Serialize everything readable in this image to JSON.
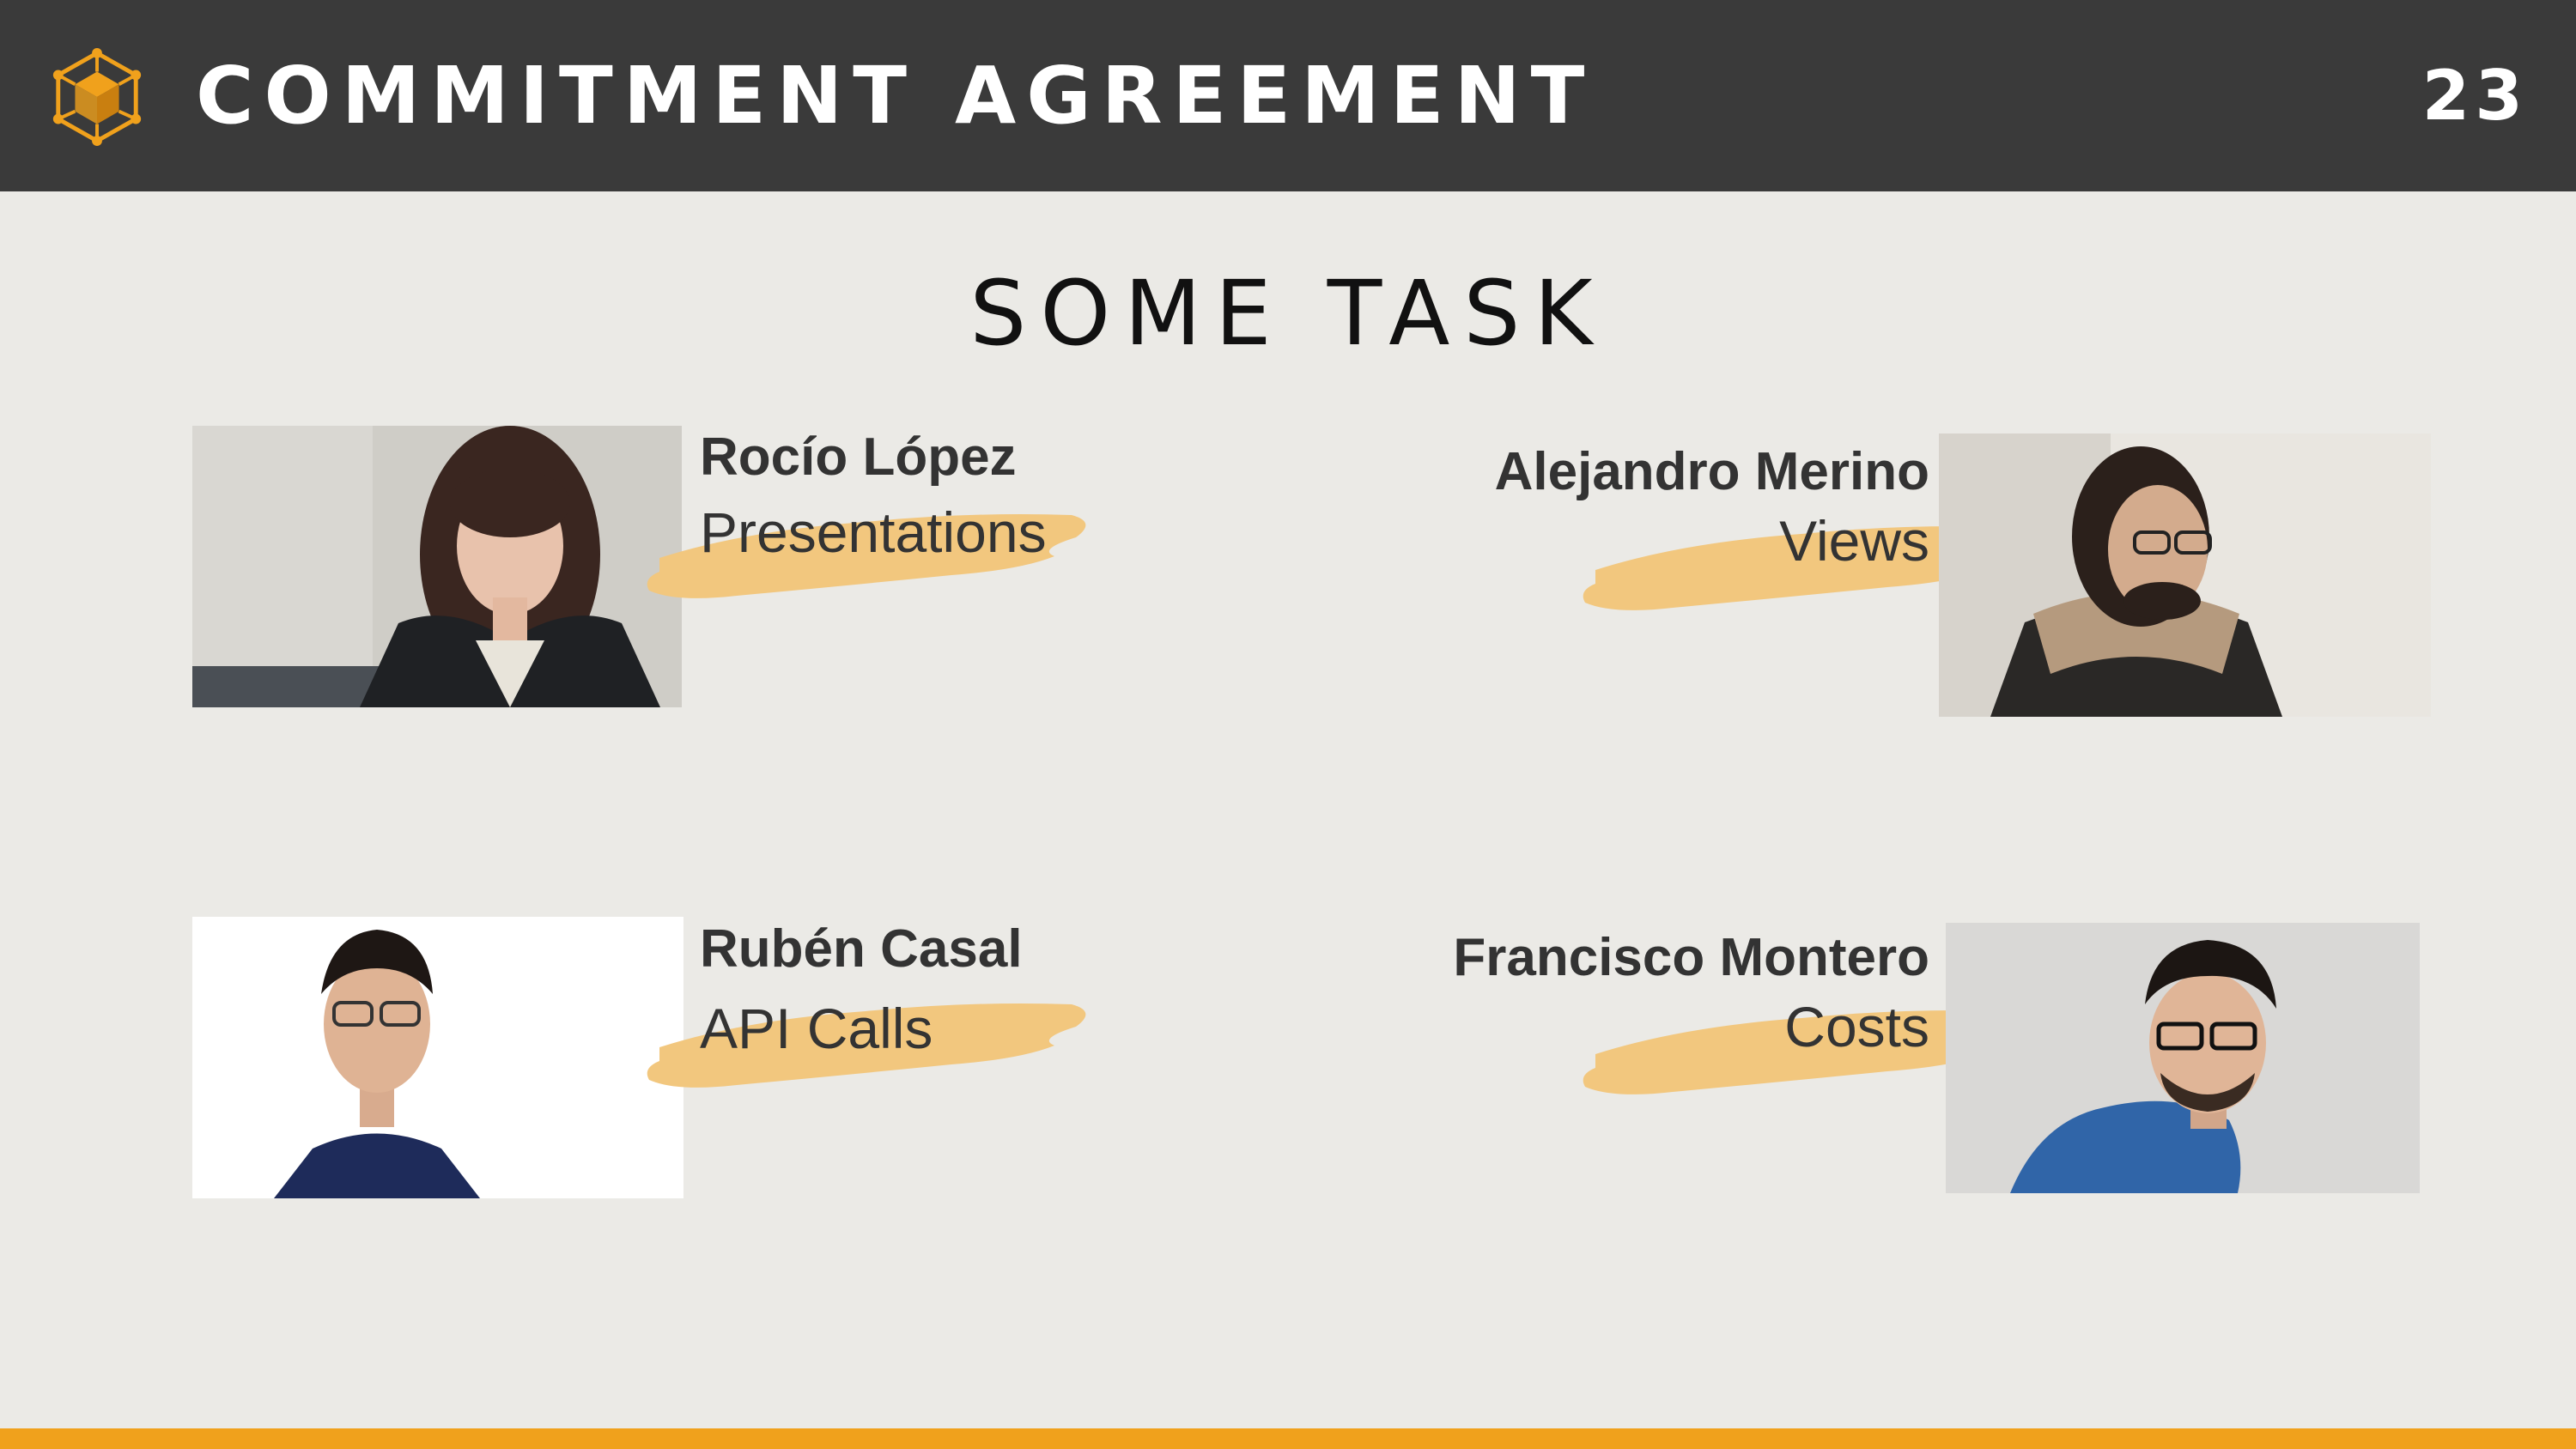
{
  "header": {
    "title": "COMMITMENT AGREEMENT",
    "page_number": "23",
    "logo_icon": "cube-network-icon",
    "accent_color": "#f0a11c",
    "background_color": "#3a3a3a"
  },
  "section": {
    "title": "SOME TASK"
  },
  "members": [
    {
      "name": "Rocío López",
      "task": "Presentations"
    },
    {
      "name": "Alejandro Merino",
      "task": "Views"
    },
    {
      "name": "Rubén Casal",
      "task": "API Calls"
    },
    {
      "name": "Francisco Montero",
      "task": "Costs"
    }
  ],
  "colors": {
    "slide_background": "#ebeae6",
    "brush_highlight": "#f2c77e",
    "text": "#333333"
  }
}
